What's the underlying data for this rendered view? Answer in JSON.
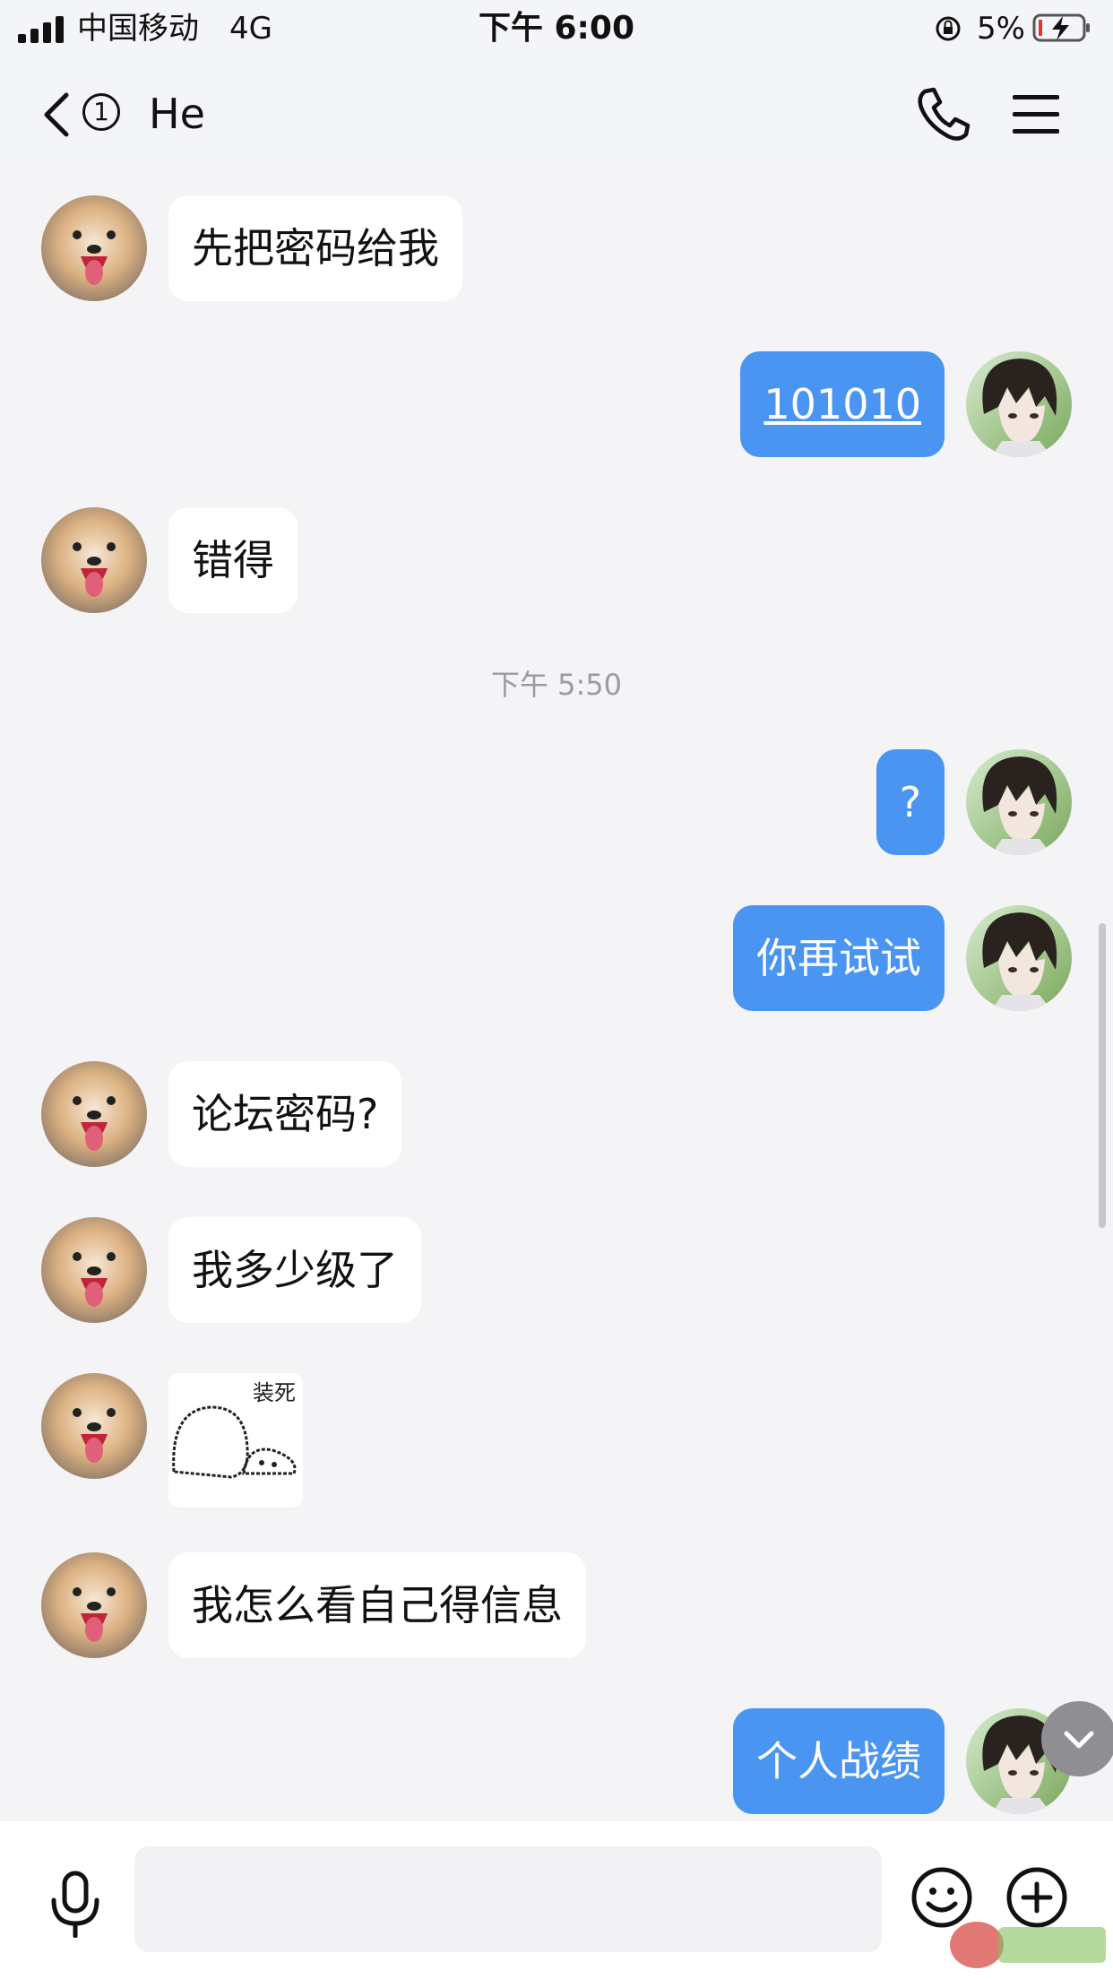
{
  "status_bar": {
    "carrier": "中国移动",
    "network": "4G",
    "time": "下午 6:00",
    "battery": "5%",
    "icons": [
      "signal-icon",
      "rotation-lock-icon",
      "battery-charging-icon"
    ]
  },
  "nav": {
    "unread_count": "1",
    "title": "He",
    "icons": [
      "back-chevron-icon",
      "phone-icon",
      "menu-icon"
    ]
  },
  "messages": [
    {
      "side": "in",
      "text": "先把密码给我"
    },
    {
      "side": "out",
      "text": "101010"
    },
    {
      "side": "in",
      "text": "错得"
    },
    {
      "timestamp": "下午 5:50"
    },
    {
      "side": "out",
      "text": "?"
    },
    {
      "side": "out",
      "text": "你再试试"
    },
    {
      "side": "in",
      "text": "论坛密码?"
    },
    {
      "side": "in",
      "text": "我多少级了"
    },
    {
      "side": "in",
      "sticker_caption": "装死"
    },
    {
      "side": "in",
      "text": "我怎么看自己得信息"
    },
    {
      "side": "out",
      "text": "个人战绩"
    }
  ],
  "input": {
    "placeholder": "",
    "icons": [
      "microphone-icon",
      "emoji-icon",
      "plus-icon"
    ]
  },
  "colors": {
    "outgoing_bubble": "#4a94f2",
    "incoming_bubble": "#ffffff",
    "background": "#f4f4f6"
  }
}
